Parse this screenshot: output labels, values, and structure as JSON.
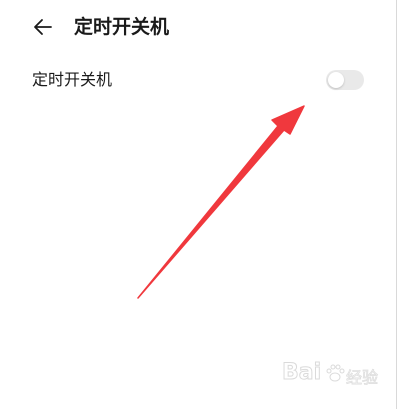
{
  "header": {
    "title": "定时开关机",
    "back_icon": "arrow-left-icon"
  },
  "settings": {
    "items": [
      {
        "label": "定时开关机",
        "enabled": false
      }
    ]
  },
  "colors": {
    "toggle_off_track": "#e9e9e9",
    "annotation_arrow": "#f0383d",
    "text_primary": "#1a1a1a"
  },
  "watermark": {
    "logo_text": "Bai",
    "sub_text": "经验"
  }
}
